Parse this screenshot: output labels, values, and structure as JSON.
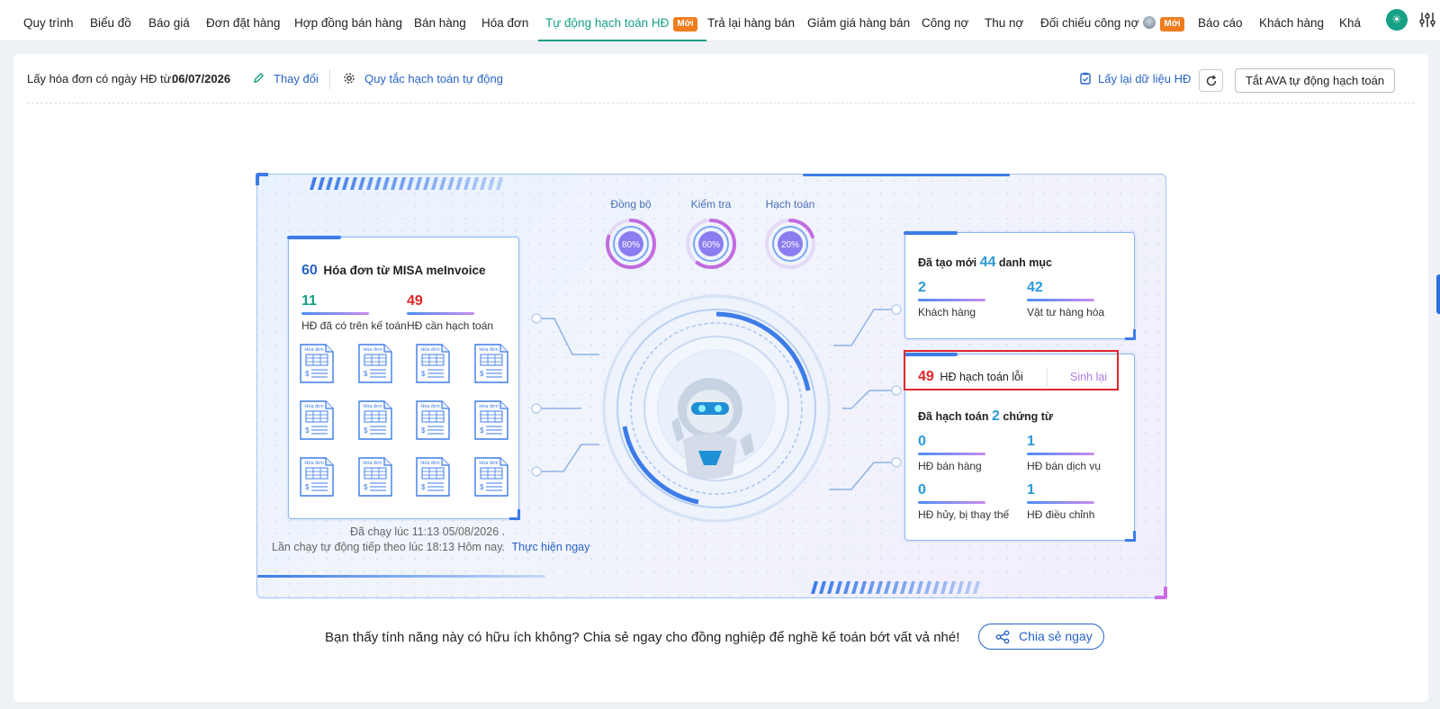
{
  "nav": {
    "items": [
      {
        "label": "Quy trình"
      },
      {
        "label": "Biểu đồ"
      },
      {
        "label": "Báo giá"
      },
      {
        "label": "Đơn đặt hàng"
      },
      {
        "label": "Hợp đồng bán hàng"
      },
      {
        "label": "Bán hàng"
      },
      {
        "label": "Hóa đơn"
      },
      {
        "label": "Tự động hạch toán HĐ",
        "badge": "Mới"
      },
      {
        "label": "Trả lại hàng bán"
      },
      {
        "label": "Giảm giá hàng bán"
      },
      {
        "label": "Công nợ"
      },
      {
        "label": "Thu nợ"
      },
      {
        "label": "Đối chiếu công nợ",
        "badge": "Mới"
      },
      {
        "label": "Báo cáo"
      },
      {
        "label": "Khách hàng"
      },
      {
        "label": "Khá"
      }
    ]
  },
  "toolbar": {
    "date_label": "Lấy hóa đơn có ngày HĐ từ:",
    "date_value": "06/07/2026",
    "change_label": "Thay đổi",
    "rules_label": "Quy tắc hạch toán tự động",
    "reload_label": "Lấy lại dữ liệu HĐ",
    "turnoff_label": "Tắt AVA tự động hạch toán"
  },
  "gauges": [
    {
      "label": "Đồng bộ",
      "percent": 80,
      "text": "80%"
    },
    {
      "label": "Kiểm tra",
      "percent": 60,
      "text": "60%"
    },
    {
      "label": "Hạch toán",
      "percent": 20,
      "text": "20%"
    }
  ],
  "invoice_card": {
    "count": "60",
    "title": "Hóa đơn từ MISA meInvoice",
    "existing_count": "11",
    "existing_label": "HĐ đã có trên kế toán",
    "pending_count": "49",
    "pending_label": "HĐ cần hạch toán",
    "icon_label": "Hóa đơn"
  },
  "run_info": {
    "last_run": "Đã chạy lúc 11:13 05/08/2026 .",
    "next_run": "Lần chạy tự động tiếp theo lúc 18:13 Hôm nay.",
    "run_now": "Thực hiện ngay"
  },
  "category_card": {
    "prefix": "Đã tạo mới",
    "count": "44",
    "suffix": "danh mục",
    "customers_count": "2",
    "customers_label": "Khách hàng",
    "materials_count": "42",
    "materials_label": "Vật tư hàng hóa"
  },
  "error_row": {
    "count": "49",
    "label": "HĐ hạch toán lỗi",
    "regenerate": "Sinh lại"
  },
  "accounted_card": {
    "prefix": "Đã hạch toán",
    "count": "2",
    "suffix": "chứng từ",
    "items": [
      {
        "count": "0",
        "label": "HĐ bán hàng"
      },
      {
        "count": "1",
        "label": "HĐ bán dịch vụ"
      },
      {
        "count": "0",
        "label": "HĐ hủy, bị thay thế"
      },
      {
        "count": "1",
        "label": "HĐ điều chỉnh"
      }
    ]
  },
  "footer": {
    "question": "Bạn thấy tính năng này có hữu ích không? Chia sẻ ngay cho đồng nghiệp để nghề kế toán bớt vất vả nhé!",
    "share_label": "Chia sẻ ngay"
  },
  "colors": {
    "accent": "#16a085",
    "link": "#2764c7",
    "error": "#e0262b",
    "badge": "#f07c1e"
  }
}
